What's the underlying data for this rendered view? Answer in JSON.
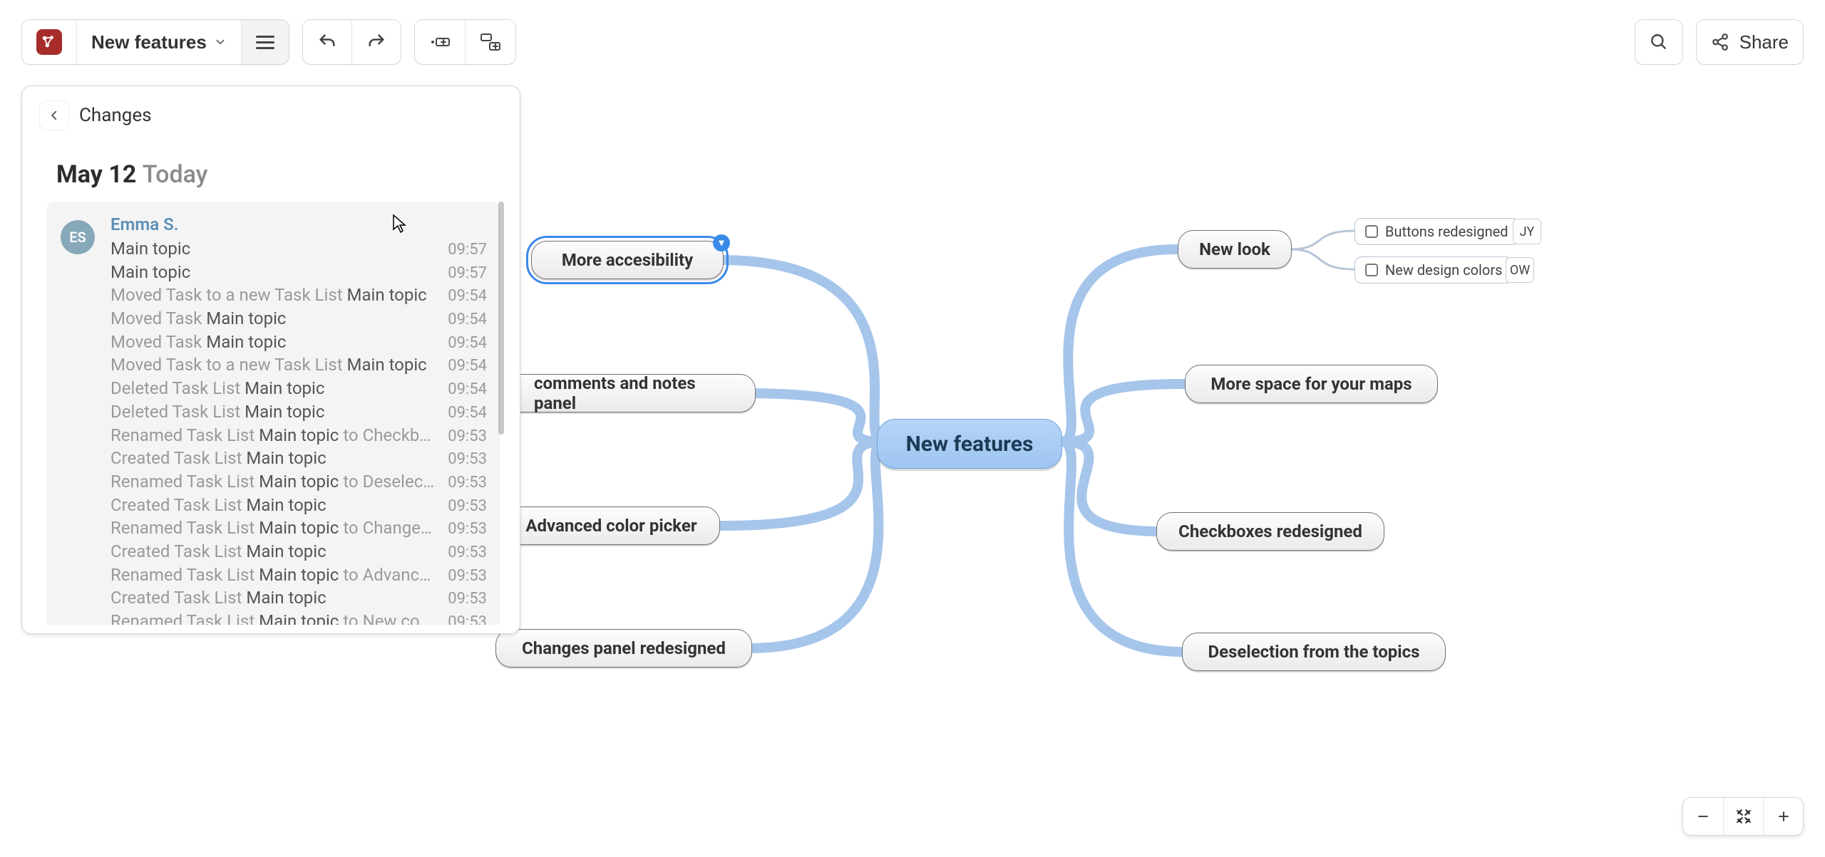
{
  "toolbar": {
    "doc_title": "New features",
    "share_label": "Share"
  },
  "panel": {
    "title": "Changes",
    "date": "May 12",
    "date_sub": "Today",
    "author": "Emma S.",
    "author_initials": "ES",
    "rows": [
      {
        "prefix": "",
        "target": "Main topic",
        "suffix": "",
        "time": "09:57"
      },
      {
        "prefix": "",
        "target": "Main topic",
        "suffix": "",
        "time": "09:57"
      },
      {
        "prefix": "Moved Task to a new Task List ",
        "target": "Main topic",
        "suffix": "",
        "time": "09:54"
      },
      {
        "prefix": "Moved Task ",
        "target": "Main topic",
        "suffix": "",
        "time": "09:54"
      },
      {
        "prefix": "Moved Task ",
        "target": "Main topic",
        "suffix": "",
        "time": "09:54"
      },
      {
        "prefix": "Moved Task to a new Task List ",
        "target": "Main topic",
        "suffix": "",
        "time": "09:54"
      },
      {
        "prefix": "Deleted Task List ",
        "target": "Main topic",
        "suffix": "",
        "time": "09:54"
      },
      {
        "prefix": "Deleted Task List ",
        "target": "Main topic",
        "suffix": "",
        "time": "09:54"
      },
      {
        "prefix": "Renamed Task List ",
        "target": "Main topic",
        "suffix": " to Checkboxe…",
        "time": "09:53"
      },
      {
        "prefix": "Created Task List ",
        "target": "Main topic",
        "suffix": "",
        "time": "09:53"
      },
      {
        "prefix": "Renamed Task List ",
        "target": "Main topic",
        "suffix": " to Deselectio…",
        "time": "09:53"
      },
      {
        "prefix": "Created Task List ",
        "target": "Main topic",
        "suffix": "",
        "time": "09:53"
      },
      {
        "prefix": "Renamed Task List ",
        "target": "Main topic",
        "suffix": " to Changes p…",
        "time": "09:53"
      },
      {
        "prefix": "Created Task List ",
        "target": "Main topic",
        "suffix": "",
        "time": "09:53"
      },
      {
        "prefix": "Renamed Task List ",
        "target": "Main topic",
        "suffix": " to Advanced …",
        "time": "09:53"
      },
      {
        "prefix": "Created Task List ",
        "target": "Main topic",
        "suffix": "",
        "time": "09:53"
      },
      {
        "prefix": "Renamed Task List ",
        "target": "Main topic",
        "suffix": " to New comm…",
        "time": "09:53"
      }
    ]
  },
  "mindmap": {
    "root": "New features",
    "left": [
      "More accesibility",
      "comments and notes panel",
      "Advanced color picker",
      "Changes panel redesigned"
    ],
    "right": [
      "New look",
      "More space for your maps",
      "Checkboxes redesigned",
      "Deselection from the topics"
    ],
    "sub": [
      {
        "label": "Buttons redesigned",
        "initials": "JY"
      },
      {
        "label": "New design colors",
        "initials": "OW"
      }
    ]
  }
}
